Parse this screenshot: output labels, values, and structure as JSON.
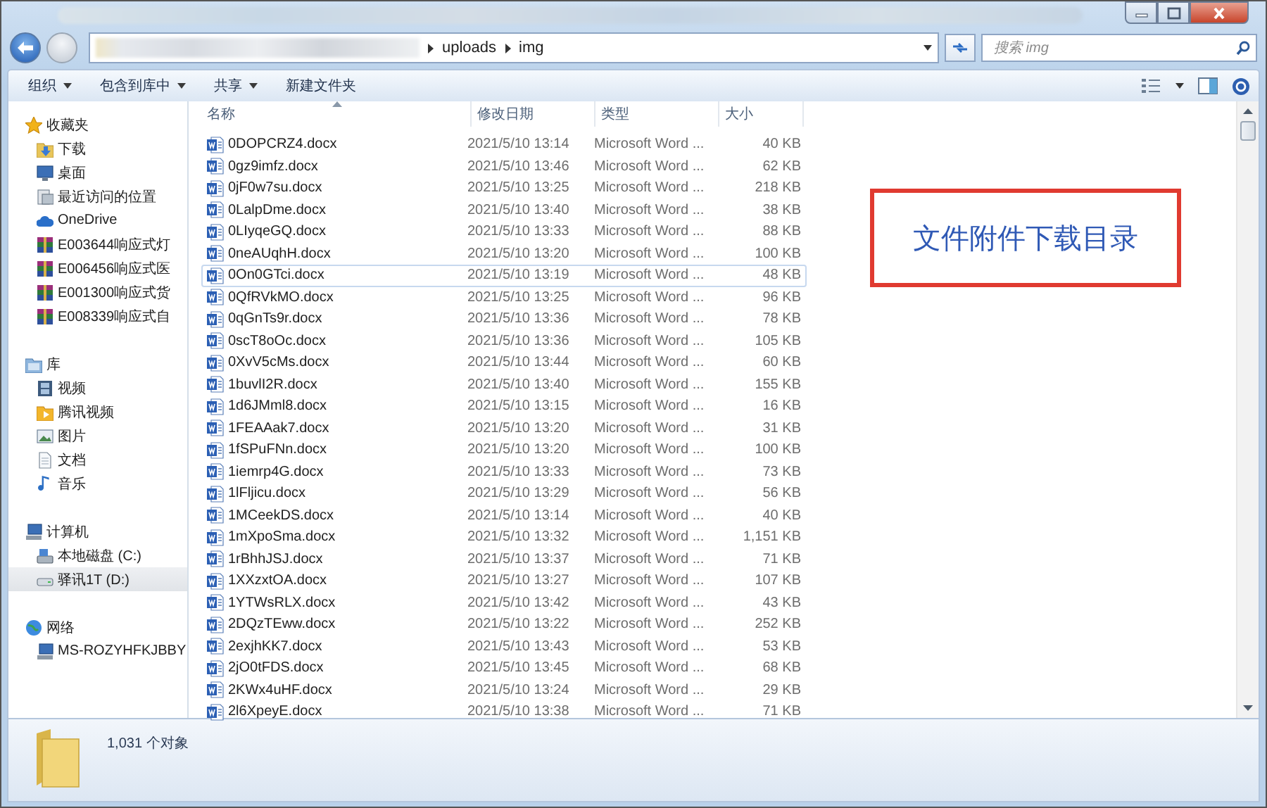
{
  "address_bar": {
    "path": [
      {
        "label": "uploads"
      },
      {
        "label": "img"
      }
    ]
  },
  "search": {
    "placeholder": "搜索 img"
  },
  "toolbar": {
    "buttons": [
      {
        "label": "组织",
        "dropdown": true
      },
      {
        "label": "包含到库中",
        "dropdown": true
      },
      {
        "label": "共享",
        "dropdown": true
      },
      {
        "label": "新建文件夹",
        "dropdown": false
      }
    ]
  },
  "sidebar": {
    "sections": [
      {
        "label": "收藏夹",
        "children": [
          {
            "label": "下载",
            "selected": false
          },
          {
            "label": "桌面",
            "selected": false
          },
          {
            "label": "最近访问的位置",
            "selected": false
          },
          {
            "label": "OneDrive",
            "selected": false
          },
          {
            "label": "E003644响应式灯",
            "selected": false
          },
          {
            "label": "E006456响应式医",
            "selected": false
          },
          {
            "label": "E001300响应式货",
            "selected": false
          },
          {
            "label": "E008339响应式自",
            "selected": false
          }
        ]
      },
      {
        "label": "库",
        "children": [
          {
            "label": "视频",
            "selected": false
          },
          {
            "label": "腾讯视频",
            "selected": false
          },
          {
            "label": "图片",
            "selected": false
          },
          {
            "label": "文档",
            "selected": false
          },
          {
            "label": "音乐",
            "selected": false
          }
        ]
      },
      {
        "label": "计算机",
        "children": [
          {
            "label": "本地磁盘 (C:)",
            "selected": false
          },
          {
            "label": "驿讯1T (D:)",
            "selected": true
          }
        ]
      },
      {
        "label": "网络",
        "children": [
          {
            "label": "MS-ROZYHFKJBBY",
            "selected": false
          }
        ]
      }
    ]
  },
  "file_list": {
    "columns": [
      "名称",
      "修改日期",
      "类型",
      "大小"
    ],
    "rows": [
      {
        "name": "0DOPCRZ4.docx",
        "modified": "2021/5/10 13:14",
        "type": "Microsoft Word ...",
        "size": "40 KB",
        "selected": false
      },
      {
        "name": "0gz9imfz.docx",
        "modified": "2021/5/10 13:46",
        "type": "Microsoft Word ...",
        "size": "62 KB",
        "selected": false
      },
      {
        "name": "0jF0w7su.docx",
        "modified": "2021/5/10 13:25",
        "type": "Microsoft Word ...",
        "size": "218 KB",
        "selected": false
      },
      {
        "name": "0LalpDme.docx",
        "modified": "2021/5/10 13:40",
        "type": "Microsoft Word ...",
        "size": "38 KB",
        "selected": false
      },
      {
        "name": "0LIyqeGQ.docx",
        "modified": "2021/5/10 13:33",
        "type": "Microsoft Word ...",
        "size": "88 KB",
        "selected": false
      },
      {
        "name": "0neAUqhH.docx",
        "modified": "2021/5/10 13:20",
        "type": "Microsoft Word ...",
        "size": "100 KB",
        "selected": false
      },
      {
        "name": "0On0GTci.docx",
        "modified": "2021/5/10 13:19",
        "type": "Microsoft Word ...",
        "size": "48 KB",
        "selected": true
      },
      {
        "name": "0QfRVkMO.docx",
        "modified": "2021/5/10 13:25",
        "type": "Microsoft Word ...",
        "size": "96 KB",
        "selected": false
      },
      {
        "name": "0qGnTs9r.docx",
        "modified": "2021/5/10 13:36",
        "type": "Microsoft Word ...",
        "size": "78 KB",
        "selected": false
      },
      {
        "name": "0scT8oOc.docx",
        "modified": "2021/5/10 13:36",
        "type": "Microsoft Word ...",
        "size": "105 KB",
        "selected": false
      },
      {
        "name": "0XvV5cMs.docx",
        "modified": "2021/5/10 13:44",
        "type": "Microsoft Word ...",
        "size": "60 KB",
        "selected": false
      },
      {
        "name": "1buvlI2R.docx",
        "modified": "2021/5/10 13:40",
        "type": "Microsoft Word ...",
        "size": "155 KB",
        "selected": false
      },
      {
        "name": "1d6JMml8.docx",
        "modified": "2021/5/10 13:15",
        "type": "Microsoft Word ...",
        "size": "16 KB",
        "selected": false
      },
      {
        "name": "1FEAAak7.docx",
        "modified": "2021/5/10 13:20",
        "type": "Microsoft Word ...",
        "size": "31 KB",
        "selected": false
      },
      {
        "name": "1fSPuFNn.docx",
        "modified": "2021/5/10 13:20",
        "type": "Microsoft Word ...",
        "size": "100 KB",
        "selected": false
      },
      {
        "name": "1iemrp4G.docx",
        "modified": "2021/5/10 13:33",
        "type": "Microsoft Word ...",
        "size": "73 KB",
        "selected": false
      },
      {
        "name": "1lFljicu.docx",
        "modified": "2021/5/10 13:29",
        "type": "Microsoft Word ...",
        "size": "56 KB",
        "selected": false
      },
      {
        "name": "1MCeekDS.docx",
        "modified": "2021/5/10 13:14",
        "type": "Microsoft Word ...",
        "size": "40 KB",
        "selected": false
      },
      {
        "name": "1mXpoSma.docx",
        "modified": "2021/5/10 13:32",
        "type": "Microsoft Word ...",
        "size": "1,151 KB",
        "selected": false
      },
      {
        "name": "1rBhhJSJ.docx",
        "modified": "2021/5/10 13:37",
        "type": "Microsoft Word ...",
        "size": "71 KB",
        "selected": false
      },
      {
        "name": "1XXzxtOA.docx",
        "modified": "2021/5/10 13:27",
        "type": "Microsoft Word ...",
        "size": "107 KB",
        "selected": false
      },
      {
        "name": "1YTWsRLX.docx",
        "modified": "2021/5/10 13:42",
        "type": "Microsoft Word ...",
        "size": "43 KB",
        "selected": false
      },
      {
        "name": "2DQzTEww.docx",
        "modified": "2021/5/10 13:22",
        "type": "Microsoft Word ...",
        "size": "252 KB",
        "selected": false
      },
      {
        "name": "2exjhKK7.docx",
        "modified": "2021/5/10 13:43",
        "type": "Microsoft Word ...",
        "size": "53 KB",
        "selected": false
      },
      {
        "name": "2jO0tFDS.docx",
        "modified": "2021/5/10 13:45",
        "type": "Microsoft Word ...",
        "size": "68 KB",
        "selected": false
      },
      {
        "name": "2KWx4uHF.docx",
        "modified": "2021/5/10 13:24",
        "type": "Microsoft Word ...",
        "size": "29 KB",
        "selected": false
      },
      {
        "name": "2l6XpeyE.docx",
        "modified": "2021/5/10 13:38",
        "type": "Microsoft Word ...",
        "size": "71 KB",
        "selected": false
      }
    ]
  },
  "status_bar": {
    "text": "1,031 个对象"
  },
  "annotation": {
    "text": "文件附件下载目录"
  }
}
